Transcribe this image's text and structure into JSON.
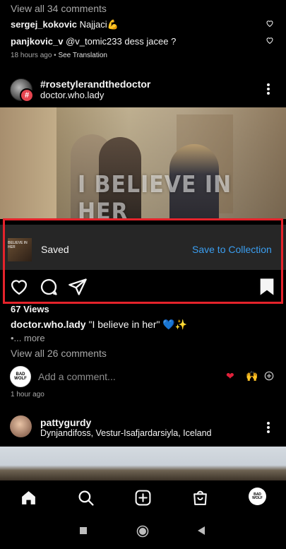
{
  "top_comments": {
    "view_all": "View all 34 comments",
    "comments": [
      {
        "user": "sergej_kokovic",
        "text": "Najjaci💪"
      },
      {
        "user": "panjkovic_v",
        "text": "@v_tomic233 dess jacee ?"
      }
    ],
    "time": "18 hours ago",
    "see_translation": "See Translation"
  },
  "post": {
    "title": "#rosetylerandthedoctor",
    "subtitle": "doctor.who.lady",
    "image_overlay": "I BELIEVE IN HER",
    "saved_label": "Saved",
    "save_to_collection": "Save to Collection",
    "saved_thumb_text": "BELIEVE IN HER",
    "views": "67 Views",
    "caption_user": "doctor.who.lady",
    "caption_text": "\"I believe in her\" 💙✨",
    "more": "•... more",
    "view_all": "View all 26 comments",
    "add_comment_placeholder": "Add a comment...",
    "quick_emoji_1": "❤",
    "quick_emoji_2": "🙌",
    "time": "1 hour ago",
    "my_avatar_text": "BAD WOLF"
  },
  "next_post": {
    "user": "pattygurdy",
    "location": "Dynjandifoss, Vestur-Isafjardarsiyla, Iceland"
  },
  "nav": {
    "items": [
      "home-icon",
      "search-icon",
      "create-icon",
      "shop-icon",
      "profile-avatar"
    ],
    "avatar_text": "BAD WOLF"
  },
  "colors": {
    "accent_blue": "#3b9ef0",
    "highlight_red": "#e5232b",
    "saved_bar": "#262626"
  }
}
